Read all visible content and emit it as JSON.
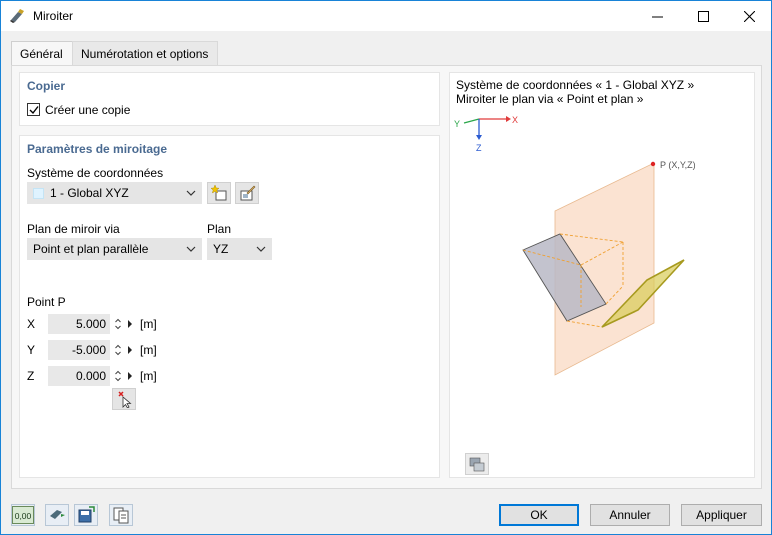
{
  "window": {
    "title": "Miroiter"
  },
  "tabs": [
    {
      "label": "Général",
      "active": true
    },
    {
      "label": "Numérotation et options",
      "active": false
    }
  ],
  "copy": {
    "title": "Copier",
    "checkbox_label": "Créer une copie",
    "checked": true
  },
  "params": {
    "title": "Paramètres de miroitage",
    "cs_label": "Système de coordonnées",
    "cs_value": "1 - Global XYZ",
    "plane_via_label": "Plan de miroir via",
    "plane_via_value": "Point et plan parallèle",
    "plane_label": "Plan",
    "plane_value": "YZ",
    "point_label": "Point P",
    "coords": [
      {
        "axis": "X",
        "value": "5.000",
        "unit": "[m]"
      },
      {
        "axis": "Y",
        "value": "-5.000",
        "unit": "[m]"
      },
      {
        "axis": "Z",
        "value": "0.000",
        "unit": "[m]"
      }
    ]
  },
  "preview": {
    "line1": "Système de coordonnées « 1 - Global XYZ »",
    "line2": "Miroiter le plan via « Point et plan »",
    "axis_x": "X",
    "axis_y": "Y",
    "axis_z": "Z",
    "point_label": "P (X,Y,Z)"
  },
  "buttons": {
    "ok": "OK",
    "cancel": "Annuler",
    "apply": "Appliquer"
  },
  "footer_icons": {
    "units_text": "0,00"
  },
  "colors": {
    "accent": "#0078d7",
    "group_title": "#4a6a91",
    "plane_fill": "#fbe3d2",
    "mirrored": "#a79a1f"
  }
}
